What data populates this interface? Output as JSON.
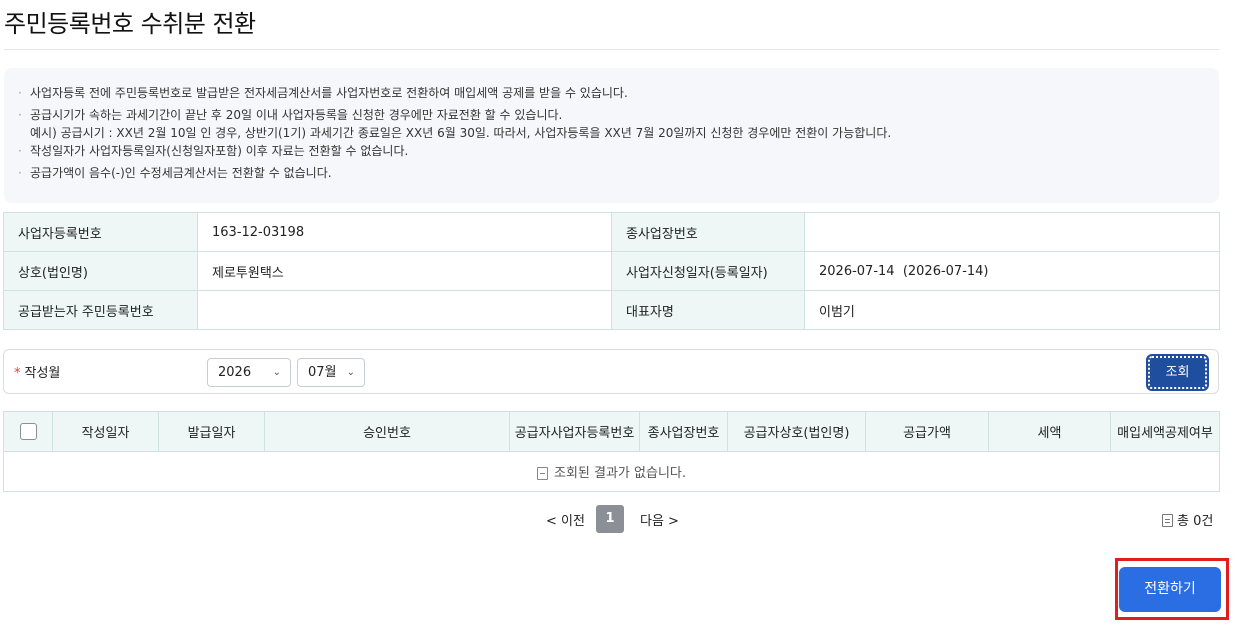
{
  "page": {
    "title": "주민등록번호 수취분 전환"
  },
  "notice": {
    "bullet": "·",
    "lines": [
      "사업자등록 전에 주민등록번호로 발급받은 전자세금계산서를 사업자번호로 전환하여 매입세액 공제를 받을 수 있습니다.",
      "공급시기가 속하는 과세기간이 끝난 후 20일 이내 사업자등록을 신청한 경우에만 자료전환 할 수 있습니다.",
      "예시) 공급시기 : XX년 2월 10일 인 경우, 상반기(1기) 과세기간 종료일은 XX년 6월 30일. 따라서, 사업자등록을 XX년 7월 20일까지 신청한 경우에만 전환이 가능합니다.",
      "작성일자가 사업자등록일자(신청일자포함) 이후 자료는 전환할 수 없습니다.",
      "공급가액이 음수(-)인 수정세금계산서는 전환할 수 없습니다."
    ]
  },
  "info": {
    "biz_no_label": "사업자등록번호",
    "biz_no_value": "163-12-03198",
    "sub_biz_label": "종사업장번호",
    "sub_biz_value": "",
    "company_label": "상호(법인명)",
    "company_value": "제로투원택스",
    "apply_date_label": "사업자신청일자(등록일자)",
    "apply_date_value": "2026-07-14  (2026-07-14)",
    "receiver_rrn_label": "공급받는자 주민등록번호",
    "receiver_rrn_value": "",
    "ceo_label": "대표자명",
    "ceo_value": "이범기"
  },
  "filter": {
    "required_mark": "*",
    "label": "작성월",
    "year_value": "2026",
    "month_value": "07월",
    "chevron": "⌄",
    "search_label": "조회"
  },
  "result": {
    "headers": [
      "작성일자",
      "발급일자",
      "승인번호",
      "공급자사업자등록번호",
      "종사업장번호",
      "공급자상호(법인명)",
      "공급가액",
      "세액",
      "매입세액공제여부"
    ],
    "empty_message": "조회된 결과가 없습니다."
  },
  "pagination": {
    "prev_label": "< 이전",
    "current_page": "1",
    "next_label": "다음 >",
    "total_label": "총 0건"
  },
  "actions": {
    "convert_label": "전환하기"
  },
  "colors": {
    "primary": "#2b6de3",
    "search_btn": "#1f4e9e",
    "highlight": "#e11d1d",
    "label_bg": "#eef7f5"
  }
}
